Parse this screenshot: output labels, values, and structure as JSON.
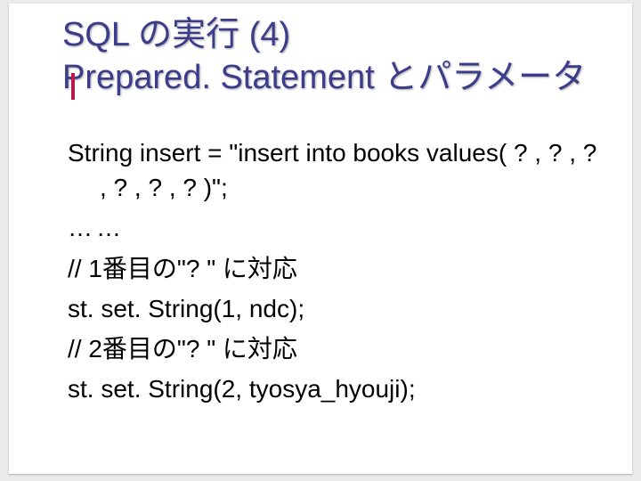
{
  "title": {
    "line1": "SQL の実行 (4)",
    "line2": "Prepared. Statement とパラメータ"
  },
  "body": {
    "p1": "String insert = \"insert into books values( ? , ? , ? , ? , ? , ? )\";",
    "dots": "……",
    "c1": "// 1番目の\"? \" に対応",
    "l1": "st. set. String(1, ndc);",
    "c2": "// 2番目の\"? \" に対応",
    "l2": "st. set. String(2, tyosya_hyouji);"
  }
}
